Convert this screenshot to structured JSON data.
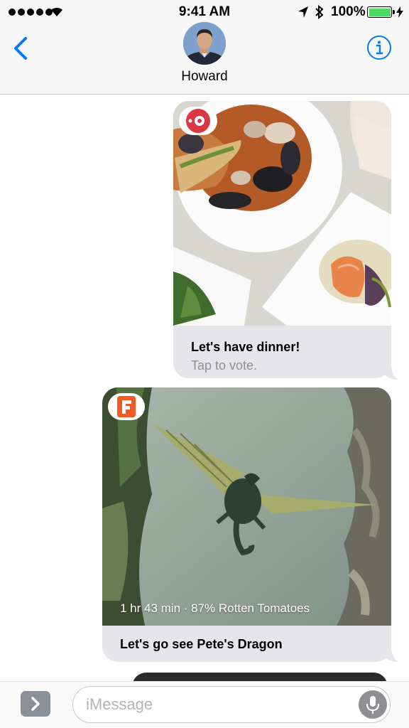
{
  "status_bar": {
    "time": "9:41 AM",
    "battery_percent": "100%",
    "signal_icon": "signal-dots-icon",
    "wifi_icon": "wifi-icon",
    "location_icon": "location-arrow-icon",
    "bluetooth_icon": "bluetooth-icon",
    "battery_icon": "battery-icon",
    "charging_icon": "charging-bolt-icon",
    "battery_color": "#4cd964"
  },
  "header": {
    "contact_name": "Howard",
    "back_icon": "chevron-left-icon",
    "info_icon": "info-icon",
    "accent_color": "#007aff"
  },
  "messages": [
    {
      "app_icon": "opentable-icon",
      "title": "Let's have dinner!",
      "subtitle": "Tap to vote."
    },
    {
      "app_icon": "fandango-icon",
      "app_badge_letter": "F",
      "meta": "1 hr 43 min · 87% Rotten Tomatoes",
      "title": "Let's go see Pete's Dragon"
    }
  ],
  "composer": {
    "placeholder": "iMessage",
    "value": "",
    "expand_icon": "chevron-right-icon",
    "mic_icon": "microphone-icon"
  },
  "colors": {
    "bubble_gray": "#e5e5ea",
    "header_bg": "#f7f7f8",
    "secondary_text": "#8e8e93"
  }
}
